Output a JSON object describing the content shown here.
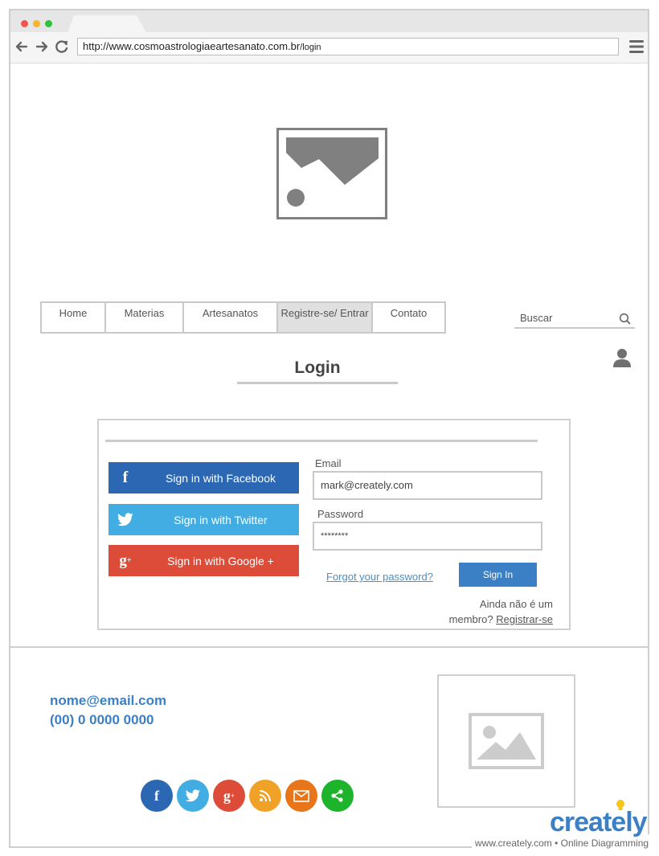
{
  "browser": {
    "url_domain": "http://www.cosmoastrologiaeartesanato.com.br",
    "url_path": "/login"
  },
  "nav": {
    "items": [
      {
        "label": "Home"
      },
      {
        "label": "Materias"
      },
      {
        "label": "Artesanatos"
      },
      {
        "label": "Registre-se/ Entrar"
      },
      {
        "label": "Contato"
      }
    ]
  },
  "search": {
    "placeholder": "Buscar"
  },
  "login": {
    "title": "Login",
    "facebook_label": "Sign in with Facebook",
    "twitter_label": "Sign in with Twitter",
    "google_label": "Sign in with Google +",
    "email_label": "Email",
    "email_value": "mark@creately.com",
    "password_label": "Password",
    "password_value": "********",
    "forgot_label": "Forgot your password?",
    "signin_label": "Sign In",
    "member_text": "Ainda não é um membro?",
    "register_label": "Registrar-se"
  },
  "footer": {
    "email": "nome@email.com",
    "phone": "(00) 0 0000 0000",
    "social_icons": [
      "facebook-icon",
      "twitter-icon",
      "google-plus-icon",
      "rss-icon",
      "mail-icon",
      "share-icon"
    ]
  },
  "watermark": {
    "brand": "creately",
    "tagline": "www.creately.com • Online Diagramming"
  },
  "colors": {
    "facebook": "#2b67b2",
    "twitter": "#42ade2",
    "google": "#dd4b39",
    "rss": "#f0a228",
    "mail": "#e8751a",
    "share": "#1db32b",
    "accent": "#3b7fc4"
  }
}
